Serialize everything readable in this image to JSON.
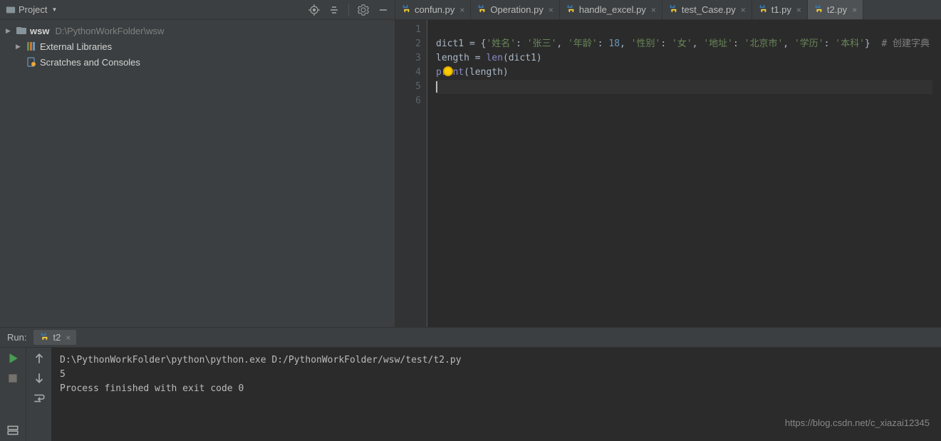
{
  "project": {
    "title": "Project",
    "tree": [
      {
        "label": "wsw",
        "path": "D:\\PythonWorkFolder\\wsw",
        "icon": "folder",
        "bold": true,
        "arrow": "▶"
      },
      {
        "label": "External Libraries",
        "icon": "library",
        "arrow": "▶"
      },
      {
        "label": "Scratches and Consoles",
        "icon": "scratch",
        "arrow": ""
      }
    ]
  },
  "tabs": [
    {
      "label": "confun.py",
      "active": false
    },
    {
      "label": "Operation.py",
      "active": false
    },
    {
      "label": "handle_excel.py",
      "active": false
    },
    {
      "label": "test_Case.py",
      "active": false
    },
    {
      "label": "t1.py",
      "active": false
    },
    {
      "label": "t2.py",
      "active": true
    }
  ],
  "editor": {
    "lines": [
      "1",
      "2",
      "3",
      "4",
      "5",
      "6"
    ],
    "code": {
      "l2": {
        "p1": "dict1 = {",
        "s1": "'姓名'",
        "c1": ": ",
        "s2": "'张三'",
        "c2": ", ",
        "s3": "'年龄'",
        "c3": ": ",
        "n1": "18",
        "c4": ", ",
        "s4": "'性别'",
        "c5": ": ",
        "s5": "'女'",
        "c6": ", ",
        "s6": "'地址'",
        "c7": ": ",
        "s7": "'北京市'",
        "c8": ", ",
        "s8": "'学历'",
        "c9": ": ",
        "s9": "'本科'",
        "p2": "}  ",
        "cm": "# 创建字典"
      },
      "l3": {
        "p1": "length = ",
        "fn": "len",
        "p2": "(dict1)"
      },
      "l4": {
        "fn": "print",
        "p1": "(length)"
      }
    }
  },
  "run": {
    "label": "Run:",
    "tab": "t2",
    "output": {
      "line1": "D:\\PythonWorkFolder\\python\\python.exe D:/PythonWorkFolder/wsw/test/t2.py",
      "line2": "5",
      "line3": "",
      "line4": "Process finished with exit code 0"
    }
  },
  "watermark": "https://blog.csdn.net/c_xiazai12345"
}
